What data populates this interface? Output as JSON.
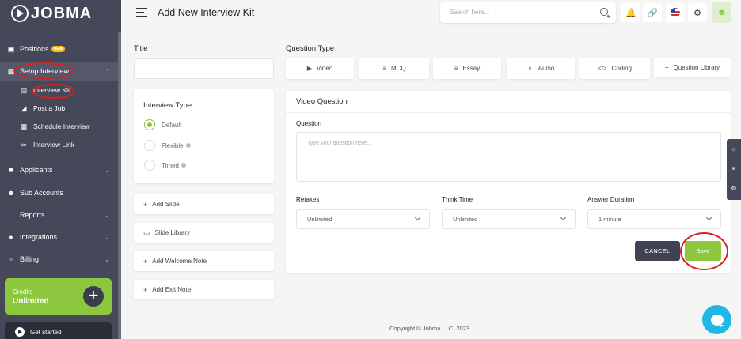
{
  "brand": {
    "name": "JOBMA"
  },
  "header": {
    "title": "Add New Interview Kit",
    "search_placeholder": "Search here..."
  },
  "sidebar": {
    "items": [
      {
        "label": "Positions",
        "badge": "NEW",
        "icon": "briefcase-icon"
      },
      {
        "label": "Setup Interview",
        "icon": "monitor-user-icon"
      },
      {
        "label": "Applicants",
        "icon": "users-icon"
      },
      {
        "label": "Sub Accounts",
        "icon": "people-icon"
      },
      {
        "label": "Reports",
        "icon": "file-icon"
      },
      {
        "label": "Integrations",
        "icon": "puzzle-icon"
      },
      {
        "label": "Billing",
        "icon": "billing-icon"
      }
    ],
    "sub_items": [
      {
        "label": "Interview Kit",
        "icon": "id-card-icon"
      },
      {
        "label": "Post a Job",
        "icon": "megaphone-icon"
      },
      {
        "label": "Schedule Interview",
        "icon": "calendar-icon"
      },
      {
        "label": "Interview Link",
        "icon": "link-icon"
      }
    ],
    "credits": {
      "label": "Credits",
      "value": "Unlimited"
    },
    "get_started": "Get started"
  },
  "form": {
    "title_label": "Title",
    "interview_type": {
      "title": "Interview Type",
      "options": [
        "Default",
        "Flexible",
        "Timed"
      ],
      "selected": "Default"
    },
    "side_buttons": [
      "Add Slide",
      "Slide Library",
      "Add Welcome Note",
      "Add Exit Note"
    ],
    "question_type_label": "Question Type",
    "question_types": [
      "Video",
      "MCQ",
      "Essay",
      "Audio",
      "Coding",
      "Question Library"
    ]
  },
  "video_question": {
    "title": "Video Question",
    "question_label": "Question",
    "question_placeholder": "Type your question here...",
    "retakes_label": "Retakes",
    "retakes_value": "Unlimited",
    "think_time_label": "Think Time",
    "think_time_value": "Unlimited",
    "answer_duration_label": "Answer Duration",
    "answer_duration_value": "1 minute",
    "cancel_label": "CANCEL",
    "save_label": "Save"
  },
  "footer": {
    "copyright": "Copyright © Jobma LLC, 2023"
  },
  "colors": {
    "accent": "#8dc63f",
    "sidebar": "#454859",
    "annotation": "#d92020",
    "chat": "#1fb8e4"
  }
}
